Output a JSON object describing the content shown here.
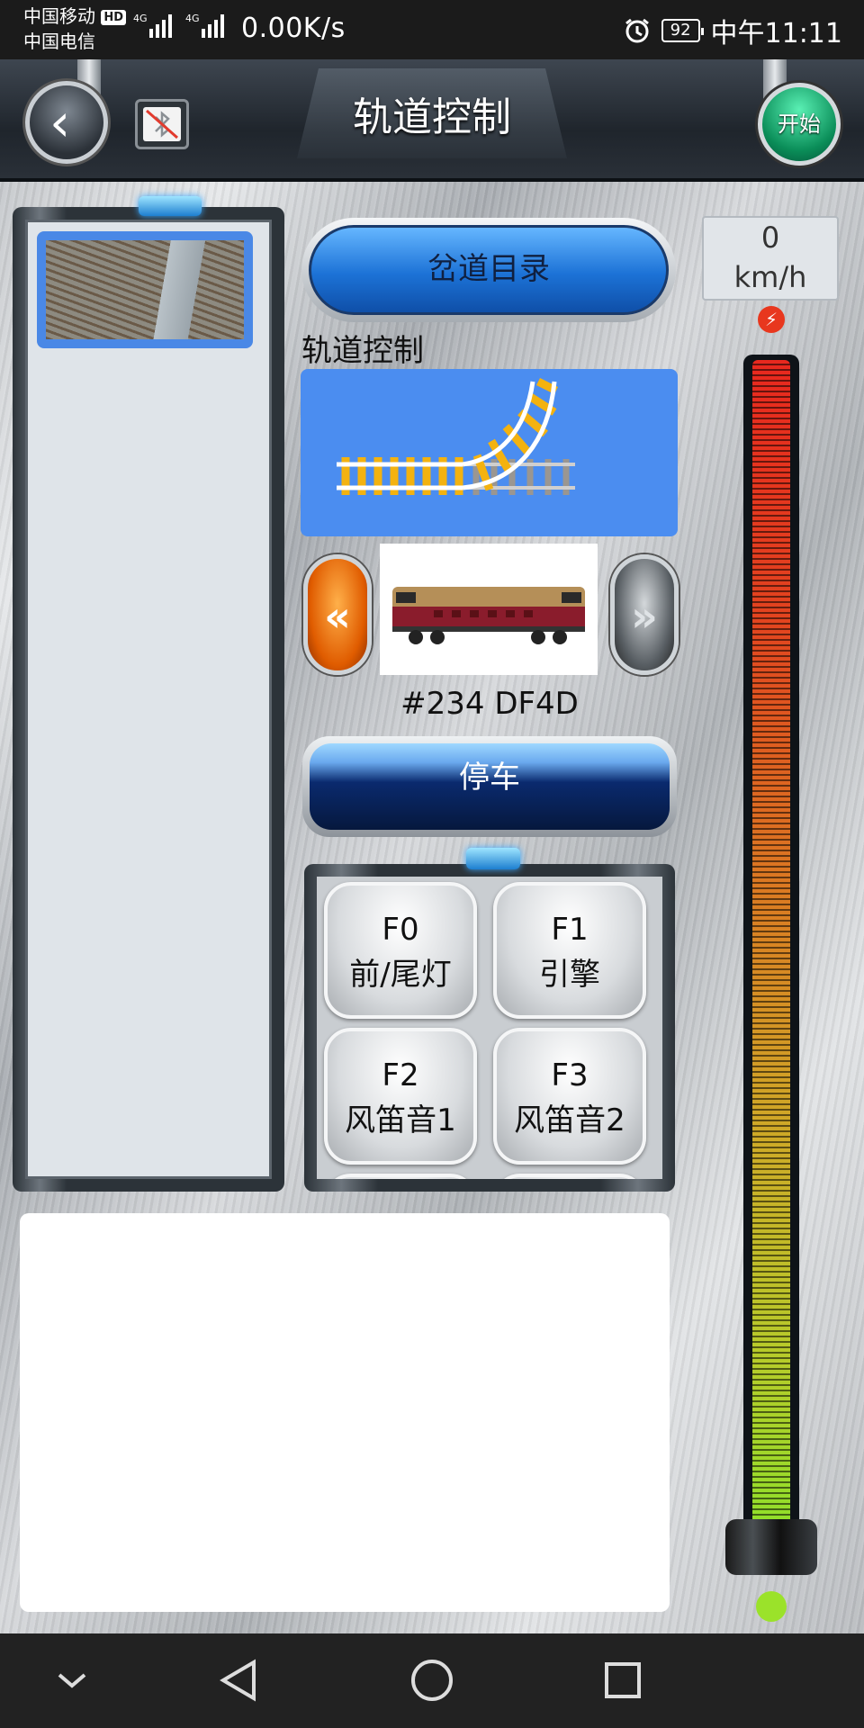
{
  "status_bar": {
    "carrier1": "中国移动",
    "hd": "HD",
    "carrier2": "中国电信",
    "net1": "4G",
    "net2": "4G",
    "speed": "0.00K/s",
    "battery": "92",
    "time": "中午11:11"
  },
  "header": {
    "title": "轨道控制",
    "start_label": "开始"
  },
  "main": {
    "junction_button": "岔道目录",
    "track_label": "轨道控制",
    "loco_name": "#234 DF4D",
    "stop_button": "停车"
  },
  "functions": [
    {
      "key": "F0",
      "name": "前/尾灯"
    },
    {
      "key": "F1",
      "name": "引擎"
    },
    {
      "key": "F2",
      "name": "风笛音1"
    },
    {
      "key": "F3",
      "name": "风笛音2"
    }
  ],
  "speedometer": {
    "value": "0",
    "unit": "km/h",
    "level": 0
  },
  "icons": {
    "back": "chevron-left-icon",
    "bluetooth": "bluetooth-disabled-icon",
    "prev": "double-chevron-left-icon",
    "next": "double-chevron-right-icon",
    "bolt": "lightning-icon"
  },
  "colors": {
    "accent": "#1c72d6",
    "start": "#0a8d58",
    "panel": "#4b8df0"
  }
}
